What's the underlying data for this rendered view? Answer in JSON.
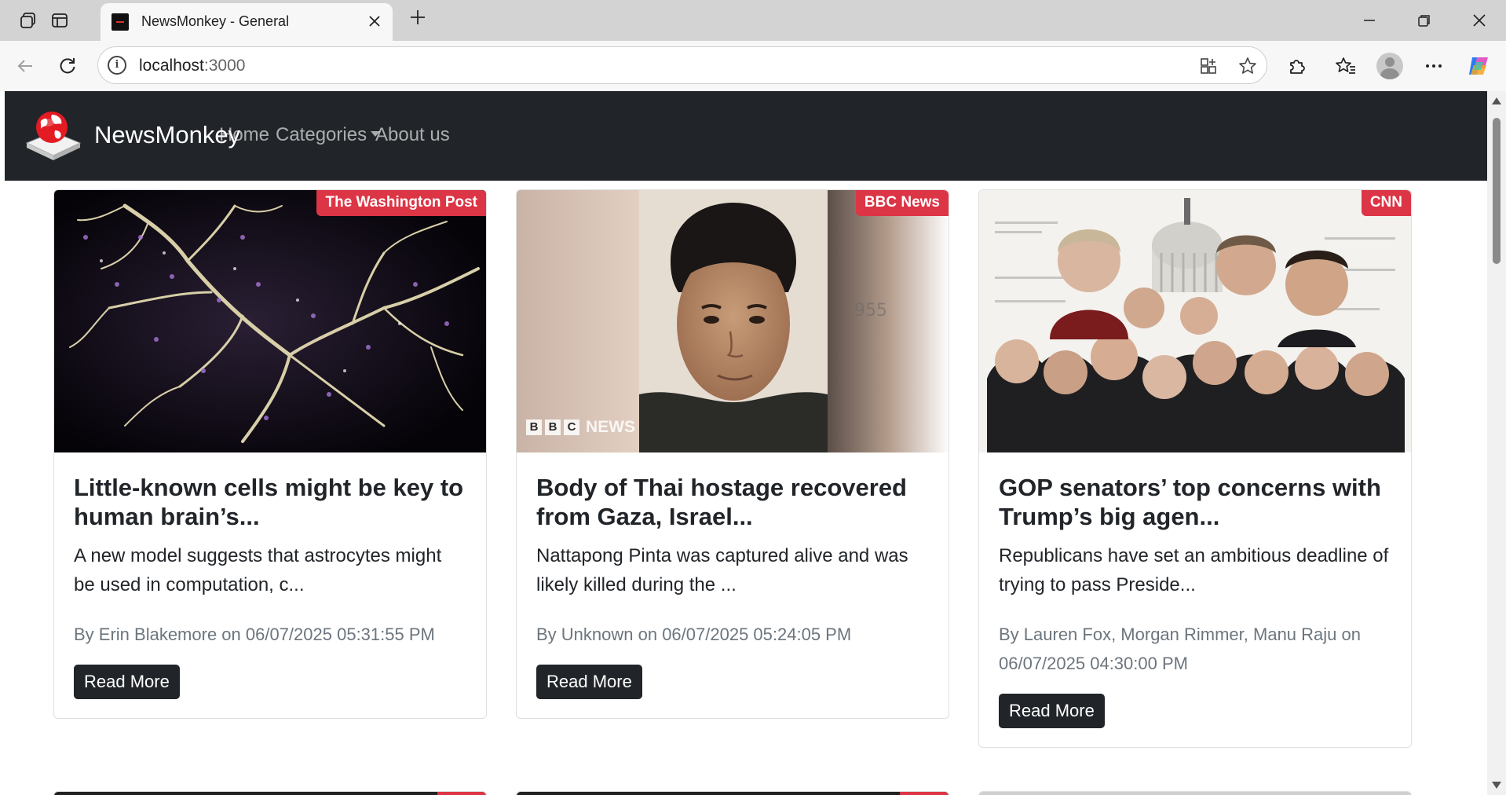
{
  "browser": {
    "tab_title": "NewsMonkey - General",
    "url_host": "localhost",
    "url_port": ":3000"
  },
  "navbar": {
    "brand": "NewsMonkey",
    "links": [
      "Home",
      "Categories",
      "About us"
    ]
  },
  "articles": [
    {
      "source": "The Washington Post",
      "title": "Little-known cells might be key to human brain’s...",
      "description": "A new model suggests that astrocytes might be used in computation, c...",
      "meta": "By Erin Blakemore on 06/07/2025 05:31:55 PM",
      "button": "Read More"
    },
    {
      "source": "BBC News",
      "title": "Body of Thai hostage recovered from Gaza, Israel...",
      "description": "Nattapong Pinta was captured alive and was likely killed during the ...",
      "meta": "By Unknown on 06/07/2025 05:24:05 PM",
      "button": "Read More",
      "image_watermark": "BBC NEWS"
    },
    {
      "source": "CNN",
      "title": "GOP senators’ top concerns with Trump’s big agen...",
      "description": "Republicans have set an ambitious deadline of trying to pass Preside...",
      "meta": "By Lauren Fox, Morgan Rimmer, Manu Raju on 06/07/2025 04:30:00 PM",
      "button": "Read More"
    }
  ],
  "colors": {
    "navbar_bg": "#212529",
    "badge_bg": "#dc3545",
    "button_bg": "#212529",
    "meta_text": "#6c757d"
  }
}
